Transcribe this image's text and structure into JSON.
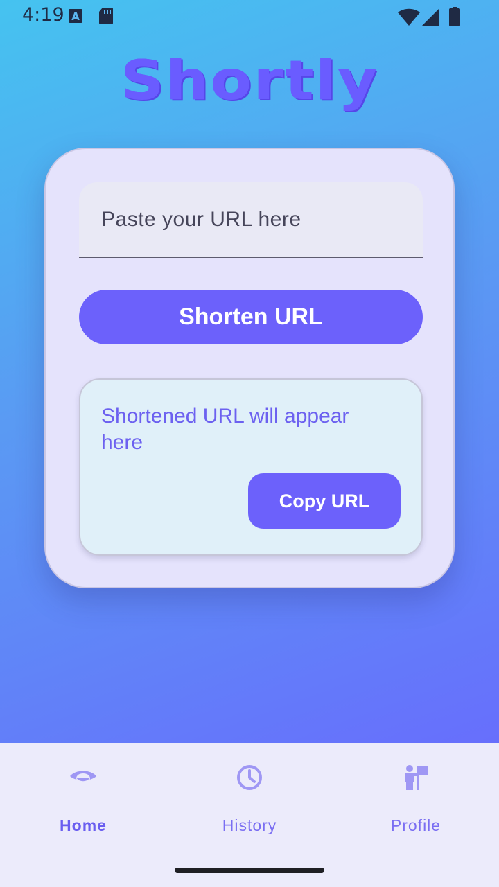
{
  "status_bar": {
    "time": "4:19",
    "icons": [
      "keyboard-a-icon",
      "sd-card-icon",
      "wifi-icon",
      "cellular-signal-icon",
      "battery-icon"
    ]
  },
  "app": {
    "title": "Shortly"
  },
  "form": {
    "url_placeholder": "Paste your URL here",
    "url_value": "",
    "shorten_label": "Shorten URL"
  },
  "result": {
    "text": "Shortened URL will appear here",
    "copy_label": "Copy URL"
  },
  "bottom_nav": {
    "items": [
      {
        "label": "Home",
        "icon": "eye-icon",
        "active": true
      },
      {
        "label": "History",
        "icon": "clock-icon",
        "active": false
      },
      {
        "label": "Profile",
        "icon": "person-flag-icon",
        "active": false
      }
    ]
  },
  "colors": {
    "accent": "#6c61fb",
    "card": "#e5e3fc",
    "result_bg": "#e0f0f9",
    "nav_bg": "#ecebfb"
  }
}
